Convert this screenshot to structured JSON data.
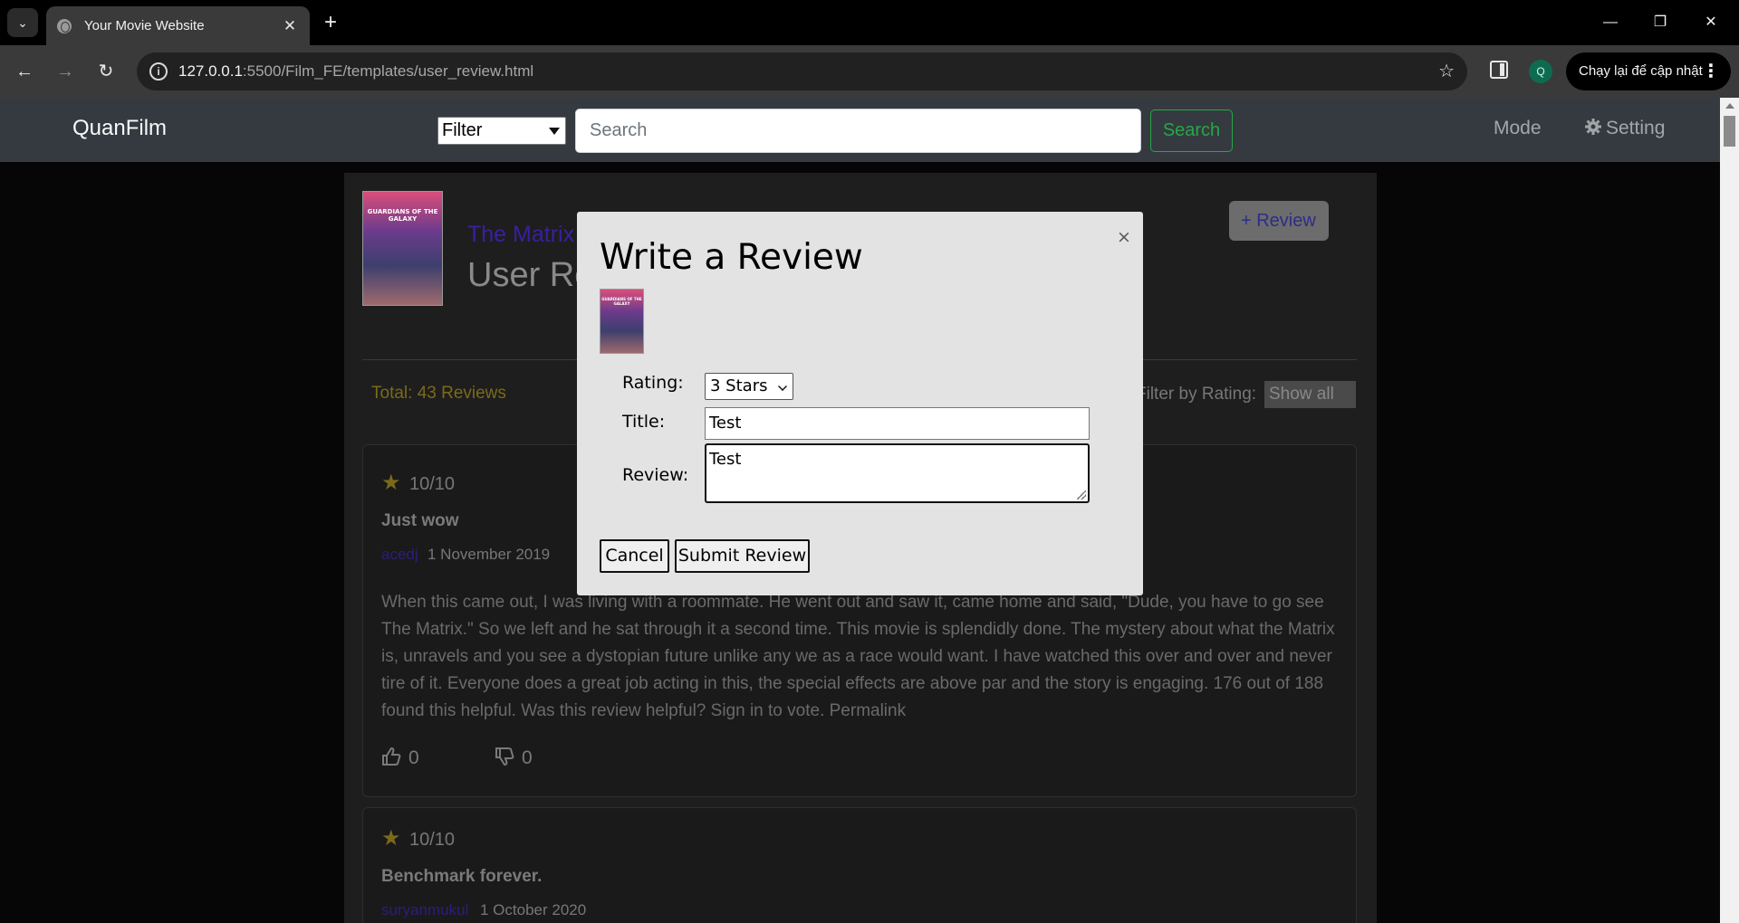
{
  "browser": {
    "tab_title": "Your Movie Website",
    "url_host": "127.0.0.1",
    "url_rest": ":5500/Film_FE/templates/user_review.html",
    "profile_initial": "Q",
    "update_label": "Chạy lại để cập nhật"
  },
  "nav": {
    "brand": "QuanFilm",
    "filter_value": "Filter",
    "search_placeholder": "Search",
    "search_button": "Search",
    "mode_link": "Mode",
    "setting_link": "Setting"
  },
  "page": {
    "movie_title": "The Matrix",
    "heading": "User Reviews",
    "add_review_button": "+ Review",
    "total_reviews": "Total: 43 Reviews",
    "filter_by_rating_label": "Filter by Rating:",
    "filter_by_rating_value": "Show all",
    "poster_text": "GUARDIANS OF THE GALAXY"
  },
  "reviews": [
    {
      "score": "10/10",
      "title": "Just wow",
      "user": "acedj",
      "date": "1 November 2019",
      "body": "When this came out, I was living with a roommate. He went out and saw it, came home and said, \"Dude, you have to go see The Matrix.\" So we left and he sat through it a second time. This movie is splendidly done. The mystery about what the Matrix is, unravels and you see a dystopian future unlike any we as a race would want. I have watched this over and over and never tire of it. Everyone does a great job acting in this, the special effects are above par and the story is engaging. 176 out of 188 found this helpful. Was this review helpful? Sign in to vote. Permalink",
      "likes": "0",
      "dislikes": "0"
    },
    {
      "score": "10/10",
      "title": "Benchmark forever.",
      "user": "suryanmukul",
      "date": "1 October 2020"
    }
  ],
  "modal": {
    "title": "Write a Review",
    "close_symbol": "×",
    "rating_label": "Rating:",
    "rating_value": "3 Stars",
    "title_label": "Title:",
    "title_value": "Test",
    "review_label": "Review:",
    "review_value": "Test",
    "cancel_button": "Cancel",
    "submit_button": "Submit Review"
  },
  "colors": {
    "navbar": "#343a40",
    "search_button": "#28a745",
    "modal_bg": "#e3e3e3"
  }
}
